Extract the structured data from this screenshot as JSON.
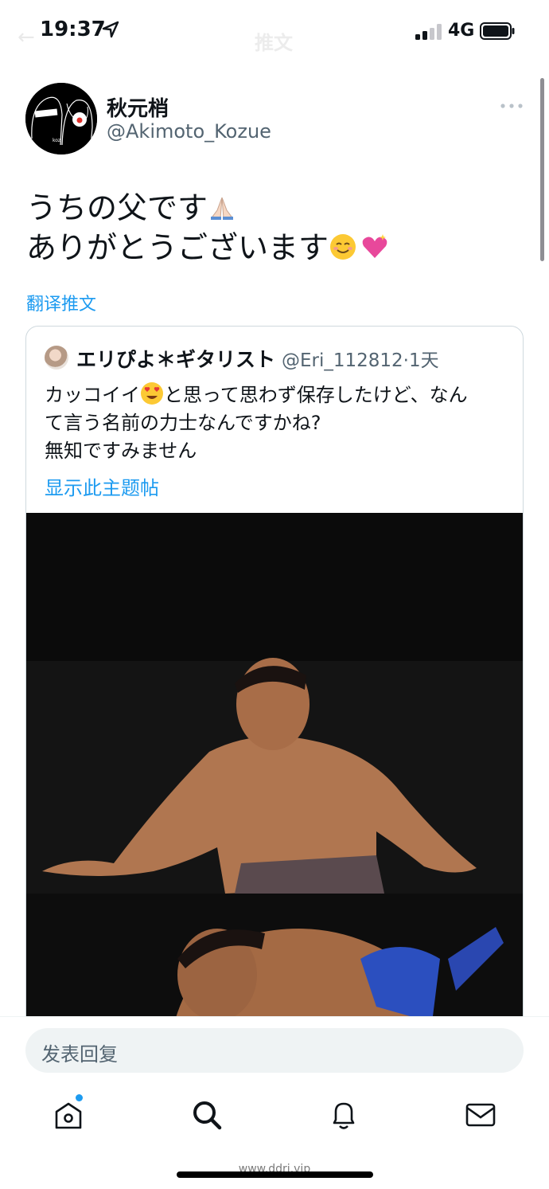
{
  "status_bar": {
    "time": "19:37",
    "network": "4G",
    "location_icon": "location-arrow-icon",
    "signal_icon": "cellular-signal-icon",
    "battery_icon": "battery-icon"
  },
  "nav": {
    "title": "推文",
    "back_icon": "back-arrow-icon",
    "back_glyph": "←"
  },
  "tweet": {
    "display_name": "秋元梢",
    "handle": "@Akimoto_Kozue",
    "avatar_text": "koz",
    "more_icon": "more-options-icon",
    "lines": [
      "うちの父です",
      "ありがとうございます"
    ],
    "emojis": [
      "folded-hands-emoji",
      "smiling-face-emoji",
      "sparkling-heart-emoji"
    ],
    "translate_label": "翻译推文"
  },
  "quote": {
    "display_name": "エリぴよ＊ギタリスト",
    "handle": "@Eri_112812",
    "separator": "·",
    "time": "1天",
    "text_part1": "カッコイイ",
    "text_part2": "と思って思わず保存したけど、なん",
    "text_line2": "て言う名前の力士なんですかね?",
    "text_line3": "無知ですみません",
    "emoji": "heart-eyes-emoji",
    "show_thread_label": "显示此主题帖",
    "photo": "sumo-wrestler-photo"
  },
  "reply": {
    "placeholder": "发表回复"
  },
  "tab_bar": {
    "items": [
      {
        "name": "home",
        "icon": "home-icon"
      },
      {
        "name": "search",
        "icon": "search-icon"
      },
      {
        "name": "notifications",
        "icon": "bell-icon"
      },
      {
        "name": "messages",
        "icon": "mail-icon"
      }
    ]
  },
  "watermark": "www.ddrj.vip",
  "colors": {
    "accent": "#1d9bf0",
    "text": "#0f1419",
    "secondary_text": "#536471",
    "border": "#cfd9de",
    "input_bg": "#eff3f4"
  }
}
